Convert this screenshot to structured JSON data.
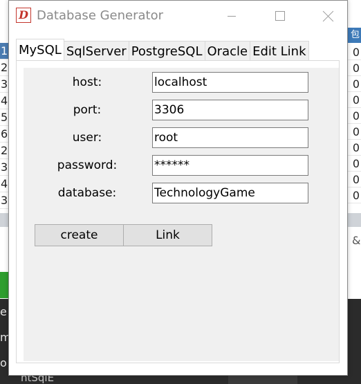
{
  "window": {
    "title": "Database Generator",
    "icon": "app-logo-icon",
    "icon_glyph": "D"
  },
  "tabs": [
    {
      "label": "MySQL",
      "active": true
    },
    {
      "label": "SqlServer",
      "active": false
    },
    {
      "label": "PostgreSQL",
      "active": false
    },
    {
      "label": "Oracle",
      "active": false
    },
    {
      "label": "Edit Link",
      "active": false
    }
  ],
  "form": {
    "host": {
      "label": "host:",
      "value": "localhost"
    },
    "port": {
      "label": "port:",
      "value": "3306"
    },
    "user": {
      "label": "user:",
      "value": "root"
    },
    "password": {
      "label": "password:",
      "value": "******"
    },
    "database": {
      "label": "database:",
      "value": "TechnologyGame"
    }
  },
  "buttons": {
    "create": "create",
    "link": "Link"
  },
  "background": {
    "left_rows": [
      "1",
      "2",
      "3",
      "4",
      "5",
      "6",
      "2",
      "3",
      "4",
      "3"
    ],
    "right_rows": [
      "0",
      "0",
      "0",
      "0",
      "0",
      "0",
      "0",
      "0",
      "0",
      "0",
      "0"
    ],
    "right_header": "包",
    "left_dark_rows": [
      "e",
      "m",
      "o"
    ],
    "bottom_text": "ntSqlE",
    "right_glyph": "&"
  },
  "colors": {
    "accent": "#3d7ab8",
    "icon_red": "#c3352c",
    "panel_bg": "#f0f0f0",
    "button_bg": "#e1e1e1"
  }
}
